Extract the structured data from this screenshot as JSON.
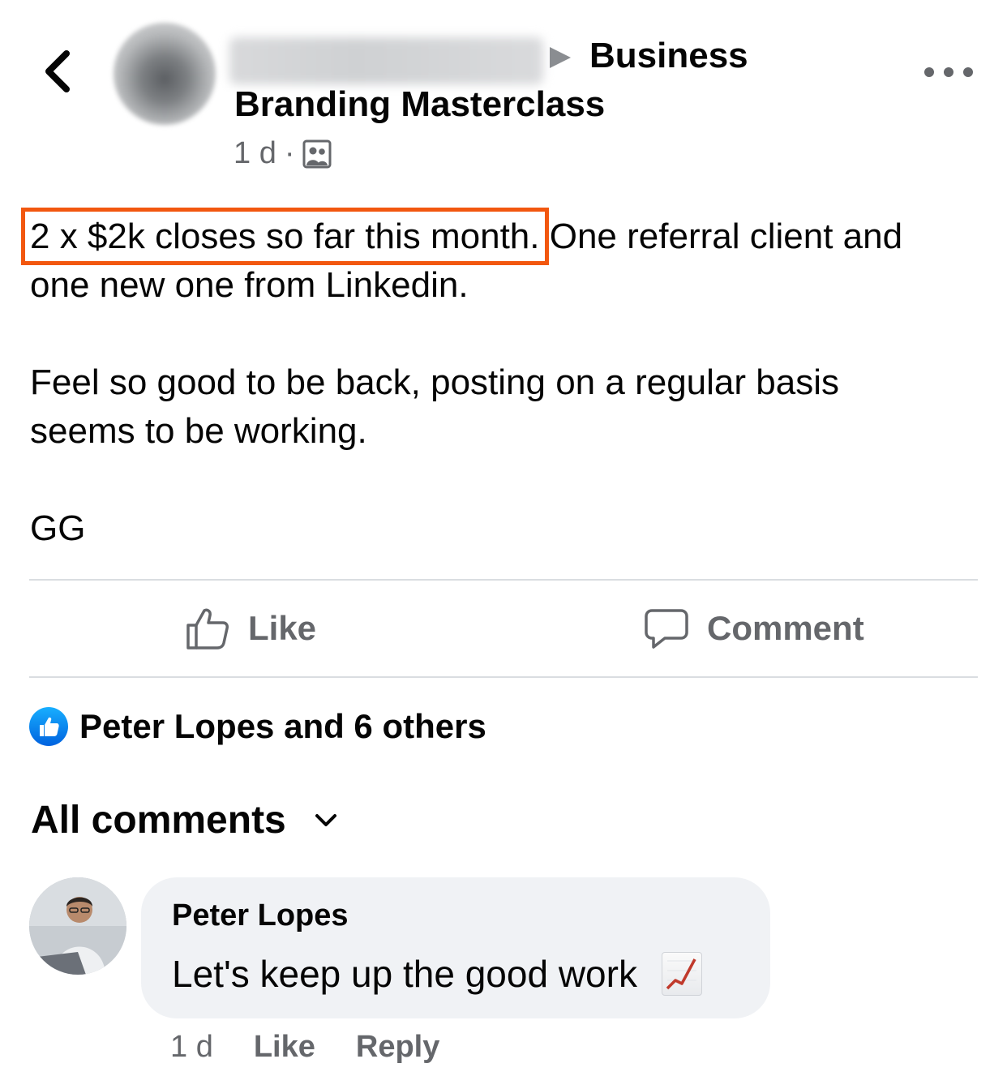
{
  "header": {
    "author_name": "",
    "arrow": "▶",
    "group_line1": "Business",
    "group_line2": "Branding Masterclass",
    "time": "1 d",
    "separator": "·",
    "audience_icon": "group-icon",
    "back_icon": "chevron-left-icon",
    "more_icon": "more-horizontal-icon"
  },
  "post": {
    "highlighted": "2 x $2k closes so far this month.",
    "line1_rest": " One referral client and",
    "line2": "one new one from Linkedin.",
    "paragraph2_line1": "Feel so good to be back, posting on a regular basis",
    "paragraph2_line2": "seems to be working.",
    "paragraph3": "GG",
    "highlight_color": "#f2570f"
  },
  "actions": {
    "like_label": "Like",
    "comment_label": "Comment",
    "like_icon": "thumbs-up-icon",
    "comment_icon": "comment-bubble-icon"
  },
  "reactions": {
    "text": "Peter Lopes and 6 others",
    "icon": "like-reaction-icon",
    "badge_color": "#1877f2"
  },
  "comments_sort": {
    "label": "All comments",
    "icon": "chevron-down-icon"
  },
  "comments": [
    {
      "author": "Peter Lopes",
      "text": "Let's keep up the good work",
      "emoji": "chart-increasing-emoji",
      "time": "1 d",
      "like_label": "Like",
      "reply_label": "Reply"
    }
  ]
}
